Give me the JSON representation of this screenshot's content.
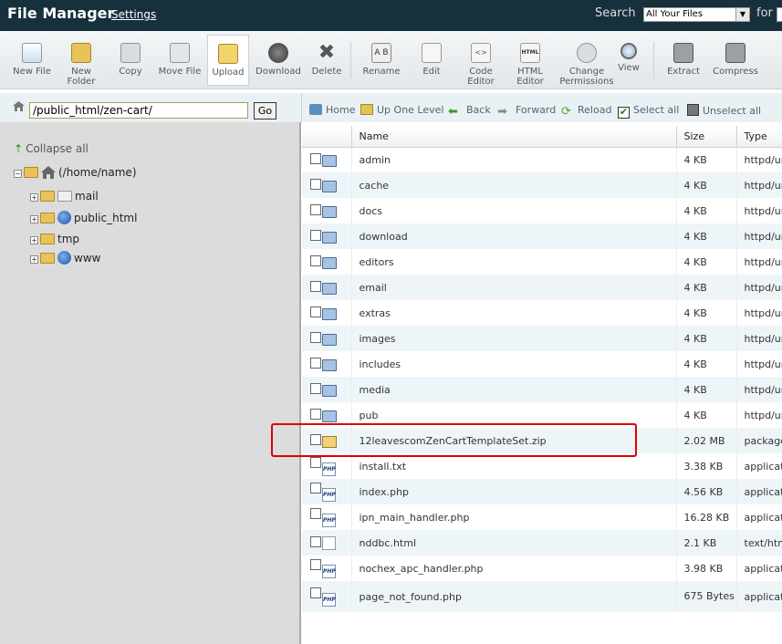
{
  "header": {
    "title": "File Manager",
    "settings_label": "Settings",
    "search_label": "Search",
    "search_scope": "All Your Files",
    "for_label": "for"
  },
  "toolbar": {
    "new_file": "New File",
    "new_folder_1": "New",
    "new_folder_2": "Folder",
    "copy": "Copy",
    "move_file": "Move File",
    "upload": "Upload",
    "download": "Download",
    "delete": "Delete",
    "rename": "Rename",
    "edit": "Edit",
    "code_editor_1": "Code",
    "code_editor_2": "Editor",
    "html_editor_1": "HTML",
    "html_editor_2": "Editor",
    "change_perm_1": "Change",
    "change_perm_2": "Permissions",
    "view": "View",
    "extract": "Extract",
    "compress": "Compress"
  },
  "path": {
    "value": "/public_html/zen-cart/",
    "go_label": "Go"
  },
  "nav": {
    "home": "Home",
    "up_one_level": "Up One Level",
    "back": "Back",
    "forward": "Forward",
    "reload": "Reload",
    "select_all": "Select all",
    "unselect_all": "Unselect all"
  },
  "tree": {
    "collapse_all": "Collapse all",
    "root": "(/home/name)",
    "mail": "mail",
    "public_html": "public_html",
    "tmp": "tmp",
    "www": "www"
  },
  "table": {
    "headers": {
      "name": "Name",
      "size": "Size",
      "type": "Type"
    },
    "rows": [
      {
        "name": "admin",
        "size": "4 KB",
        "type": "httpd/unix-directory",
        "icon": "folder-icon"
      },
      {
        "name": "cache",
        "size": "4 KB",
        "type": "httpd/unix-directory",
        "icon": "folder-icon"
      },
      {
        "name": "docs",
        "size": "4 KB",
        "type": "httpd/unix-directory",
        "icon": "folder-icon"
      },
      {
        "name": "download",
        "size": "4 KB",
        "type": "httpd/unix-directory",
        "icon": "folder-icon"
      },
      {
        "name": "editors",
        "size": "4 KB",
        "type": "httpd/unix-directory",
        "icon": "folder-icon"
      },
      {
        "name": "email",
        "size": "4 KB",
        "type": "httpd/unix-directory",
        "icon": "folder-icon"
      },
      {
        "name": "extras",
        "size": "4 KB",
        "type": "httpd/unix-directory",
        "icon": "folder-icon"
      },
      {
        "name": "images",
        "size": "4 KB",
        "type": "httpd/unix-directory",
        "icon": "folder-icon"
      },
      {
        "name": "includes",
        "size": "4 KB",
        "type": "httpd/unix-directory",
        "icon": "folder-icon"
      },
      {
        "name": "media",
        "size": "4 KB",
        "type": "httpd/unix-directory",
        "icon": "folder-icon"
      },
      {
        "name": "pub",
        "size": "4 KB",
        "type": "httpd/unix-directory",
        "icon": "folder-icon"
      },
      {
        "name": "12leavescomZenCartTemplateSet.zip",
        "size": "2.02 MB",
        "type": "package/x-generic",
        "icon": "zip-package-icon"
      },
      {
        "name": "install.txt",
        "size": "3.38 KB",
        "type": "application/x-httpd-php",
        "icon": "php-file-icon"
      },
      {
        "name": "index.php",
        "size": "4.56 KB",
        "type": "application/x-httpd-php",
        "icon": "php-file-icon"
      },
      {
        "name": "ipn_main_handler.php",
        "size": "16.28 KB",
        "type": "application/x-httpd-php",
        "icon": "php-file-icon"
      },
      {
        "name": "nddbc.html",
        "size": "2.1 KB",
        "type": "text/html",
        "icon": "html-file-icon"
      },
      {
        "name": "nochex_apc_handler.php",
        "size": "3.98 KB",
        "type": "application/x-httpd-php",
        "icon": "php-file-icon"
      },
      {
        "name": "page_not_found.php",
        "size": "675 Bytes",
        "type": "application/x-httpd-php",
        "icon": "php-file-icon"
      }
    ]
  },
  "highlight_color": "#e00000"
}
